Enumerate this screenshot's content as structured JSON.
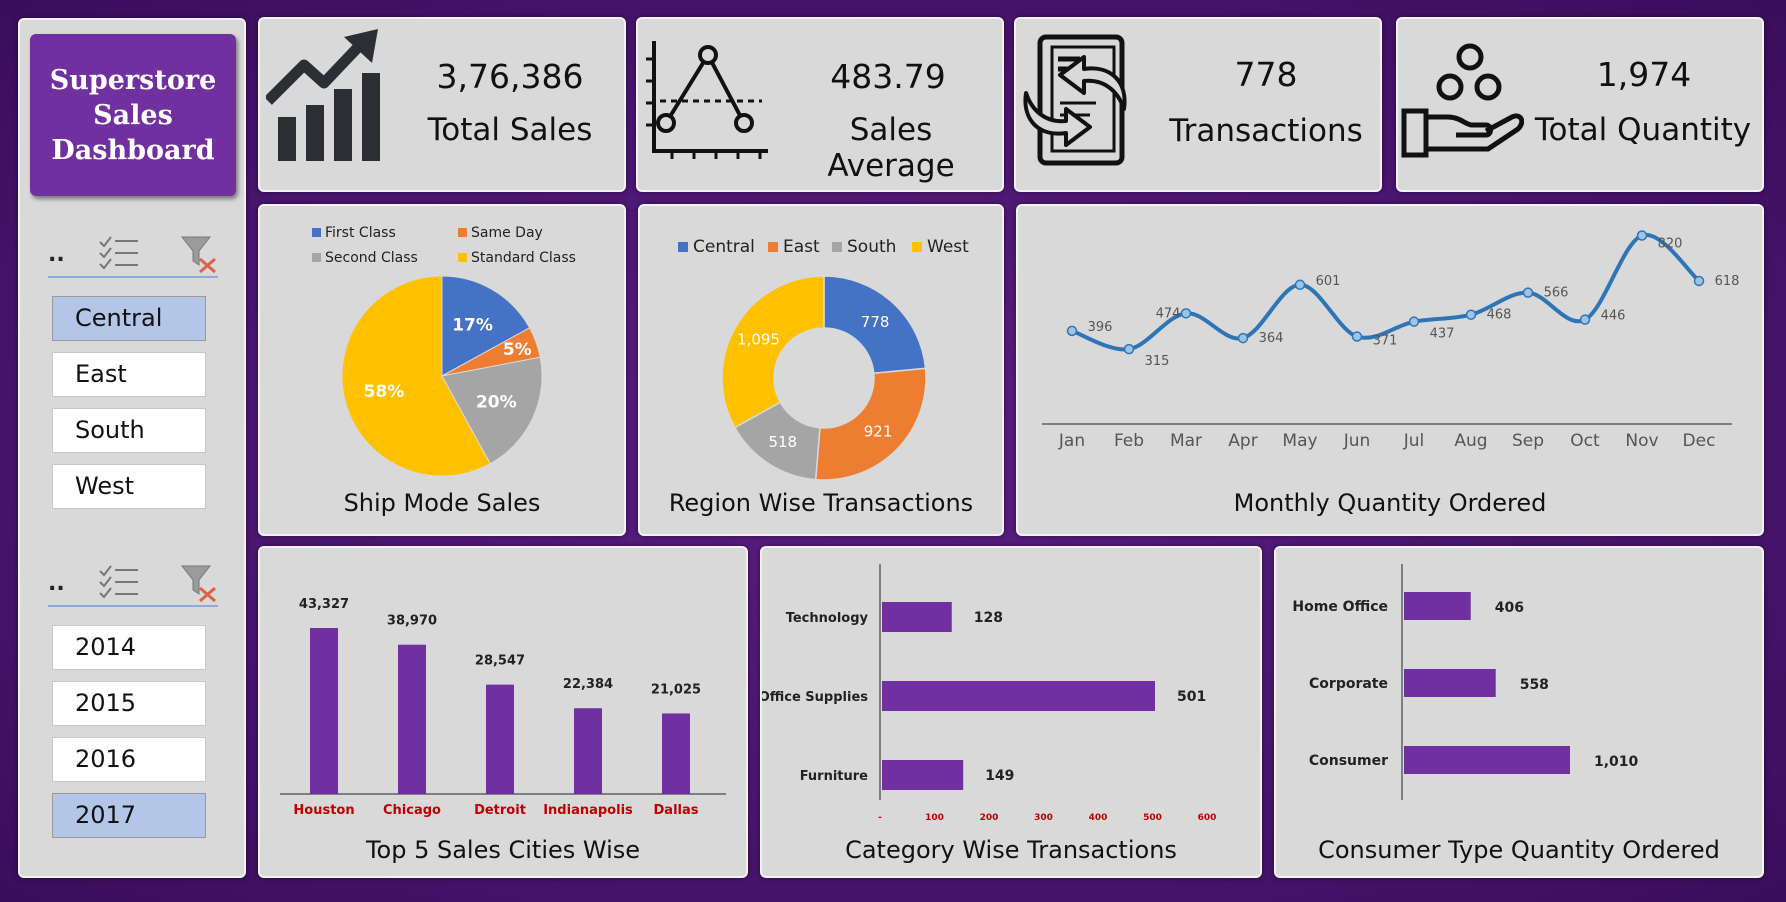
{
  "dashboard": {
    "title_lines": [
      "Superstore",
      "Sales",
      "Dashboard"
    ]
  },
  "slicers": {
    "region": {
      "header_dots": "..",
      "items": [
        {
          "label": "Central",
          "selected": true
        },
        {
          "label": "East",
          "selected": false
        },
        {
          "label": "South",
          "selected": false
        },
        {
          "label": "West",
          "selected": false
        }
      ]
    },
    "year": {
      "header_dots": "..",
      "items": [
        {
          "label": "2014",
          "selected": false
        },
        {
          "label": "2015",
          "selected": false
        },
        {
          "label": "2016",
          "selected": false
        },
        {
          "label": "2017",
          "selected": true
        }
      ]
    }
  },
  "kpis": [
    {
      "value": "3,76,386",
      "label": "Total Sales",
      "icon": "growth-chart-icon"
    },
    {
      "value": "483.79",
      "label": "Sales Average",
      "icon": "line-graph-icon"
    },
    {
      "value": "778",
      "label": "Transactions",
      "icon": "transaction-document-icon"
    },
    {
      "value": "1,974",
      "label": "Total Quantity",
      "icon": "hand-coins-icon"
    }
  ],
  "colors": {
    "accent": "#7030a0",
    "blue": "#4472c4",
    "orange": "#ed7d31",
    "gray": "#a5a5a5",
    "yellow": "#ffc000",
    "line": "#2e75b6",
    "city_label": "#c00000"
  },
  "chart_data": [
    {
      "type": "pie",
      "title": "Ship Mode Sales",
      "categories": [
        "First Class",
        "Same Day",
        "Second Class",
        "Standard Class"
      ],
      "values": [
        17,
        5,
        20,
        58
      ],
      "data_labels": [
        "17%",
        "5%",
        "20%",
        "58%"
      ],
      "colors": [
        "#4472c4",
        "#ed7d31",
        "#a5a5a5",
        "#ffc000"
      ],
      "legend": "top"
    },
    {
      "type": "donut",
      "title": "Region Wise Transactions",
      "categories": [
        "Central",
        "East",
        "South",
        "West"
      ],
      "values": [
        778,
        921,
        518,
        1095
      ],
      "data_labels": [
        "778",
        "921",
        "518",
        "1,095"
      ],
      "colors": [
        "#4472c4",
        "#ed7d31",
        "#a5a5a5",
        "#ffc000"
      ],
      "legend": "top"
    },
    {
      "type": "line",
      "title": "Monthly Quantity Ordered",
      "categories": [
        "Jan",
        "Feb",
        "Mar",
        "Apr",
        "May",
        "Jun",
        "Jul",
        "Aug",
        "Sep",
        "Oct",
        "Nov",
        "Dec"
      ],
      "values": [
        396,
        315,
        474,
        364,
        601,
        371,
        437,
        468,
        566,
        446,
        820,
        618
      ],
      "data_labels": [
        "",
        "396",
        "315",
        "474",
        "364",
        "601",
        "371",
        "437",
        "468",
        "566",
        "446",
        "820",
        "618"
      ],
      "grid": false
    },
    {
      "type": "bar",
      "title": "Top 5 Sales Cities Wise",
      "categories": [
        "Houston",
        "Chicago",
        "Detroit",
        "Indianapolis",
        "Dallas"
      ],
      "values": [
        43327,
        38970,
        28547,
        22384,
        21025
      ],
      "data_labels": [
        "43,327",
        "38,970",
        "28,547",
        "22,384",
        "21,025"
      ]
    },
    {
      "type": "bar",
      "orientation": "horizontal",
      "title": "Category Wise Transactions",
      "categories": [
        "Technology",
        "Office Supplies",
        "Furniture"
      ],
      "values": [
        128,
        501,
        149
      ],
      "data_labels": [
        "128",
        "501",
        "149"
      ],
      "xticks": [
        "-",
        "100",
        "200",
        "300",
        "400",
        "500",
        "600"
      ],
      "xlim": [
        0,
        600
      ]
    },
    {
      "type": "bar",
      "orientation": "horizontal",
      "title": "Consumer Type Quantity Ordered",
      "categories": [
        "Home Office",
        "Corporate",
        "Consumer"
      ],
      "values": [
        406,
        558,
        1010
      ],
      "data_labels": [
        "406",
        "558",
        "1,010"
      ]
    }
  ]
}
